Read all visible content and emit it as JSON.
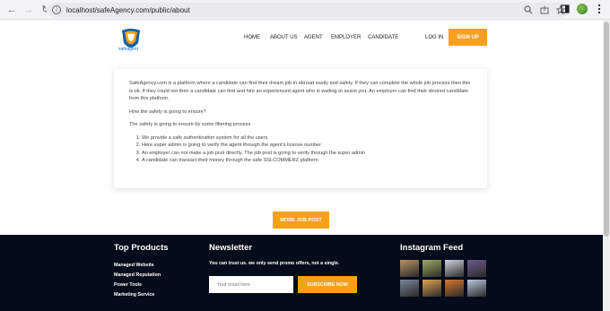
{
  "browser": {
    "url": "localhost/safeAgency.com/public/about"
  },
  "logo": {
    "text": "safeagent"
  },
  "nav": {
    "items": [
      "HOME",
      "ABOUT US",
      "AGENT",
      "EMPLOYER",
      "CANDIDATE"
    ],
    "login": "LOG IN",
    "signup": "SIGN UP"
  },
  "about": {
    "intro": "SafeAgency.com is a platform where a candidate can find their dream job in abroad easily and safely. If they can complete the whole job process then this is ok. If they could not then a candidate can find and hire an experienced agent who is waiting to assist you. An employer can find their desired candidate from this platform.",
    "question": "How the safety is going to ensure?",
    "filter_intro": "The safety is going to ensure by some filtering process",
    "rules": [
      "We provide a safe authentication system for all the users",
      "Here super admin is going to verify the agent through the agent's license number",
      "An employer can not make a job post directly. The job post is going to verify through the super admin",
      "A candidate can transact their money through the safe SSLCOMMERZ platform"
    ]
  },
  "more_job_button": "MORE JOB POST",
  "footer": {
    "products_title": "Top Products",
    "products": [
      "Managed Website",
      "Managed Reputation",
      "Power Tools",
      "Marketing Service"
    ],
    "newsletter_title": "Newsletter",
    "newsletter_text": "You can trust us. we only send promo offers, not a single.",
    "email_placeholder": "Your email here",
    "subscribe_label": "SUBSCRIBE NOW",
    "instagram_title": "Instagram Feed",
    "instagram_colors": [
      "#b79263",
      "#9cab64",
      "#cfd6df",
      "#6f5a8f",
      "#7a8697",
      "#e0a050",
      "#d8782c",
      "#b8c7dd"
    ]
  },
  "colors": {
    "accent": "#f7a01b",
    "footer_bg": "#040b1a"
  }
}
